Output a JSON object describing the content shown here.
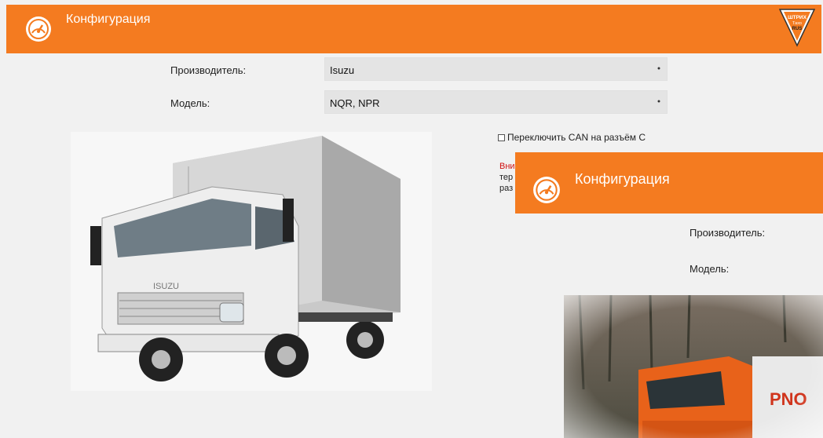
{
  "header": {
    "title": "Конфигурация",
    "logo_icon": "speedometer-icon",
    "brand": {
      "line1": "ШТРИХ",
      "line2": "Тахо",
      "line3": "RUS"
    }
  },
  "form": {
    "manufacturer_label": "Производитель:",
    "manufacturer_value": "Isuzu",
    "model_label": "Модель:",
    "model_value": "NQR, NPR",
    "can_switch_label": "Переключить CAN на разъём С",
    "can_switch_checked": false,
    "warning_red": "Вни",
    "warning_line2": "тер",
    "warning_line3": "раз"
  },
  "overlay": {
    "title": "Конфигурация",
    "manufacturer_label": "Производитель:",
    "model_label": "Модель:"
  },
  "colors": {
    "accent": "#f47b20",
    "warning": "#d01010"
  }
}
